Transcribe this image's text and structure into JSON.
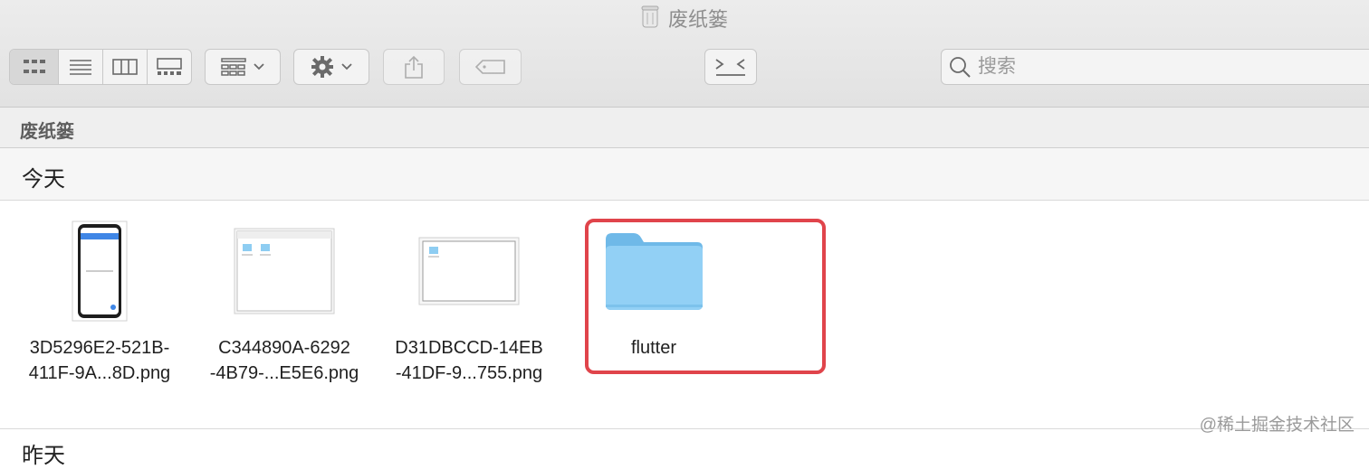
{
  "window": {
    "title": "废纸篓",
    "title_icon": "trash-icon"
  },
  "toolbar": {
    "view_buttons": [
      "icon-view-icon",
      "list-view-icon",
      "column-view-icon",
      "gallery-view-icon"
    ],
    "group_button_icon": "group-by-icon",
    "action_button_icon": "gear-icon",
    "share_button_icon": "share-icon",
    "tag_button_icon": "tag-icon",
    "terminal_button_icon": "terminal-icon"
  },
  "search": {
    "placeholder": "搜索",
    "value": ""
  },
  "path": {
    "current": "废纸篓"
  },
  "group": {
    "label": "今天"
  },
  "items": [
    {
      "line1": "3D5296E2-521B-",
      "line2": "411F-9A...8D.png",
      "kind": "phone-screenshot"
    },
    {
      "line1": "C344890A-6292",
      "line2": "-4B79-...E5E6.png",
      "kind": "window-screenshot"
    },
    {
      "line1": "D31DBCCD-14EB",
      "line2": "-41DF-9...755.png",
      "kind": "window-screenshot"
    },
    {
      "line1": "flutter",
      "line2": "",
      "kind": "folder",
      "selected": true
    }
  ],
  "next_group": {
    "label": "昨天"
  },
  "watermark": "@稀土掘金技术社区",
  "colors": {
    "selection": "#e0444b",
    "folder": "#8ecdf2"
  }
}
